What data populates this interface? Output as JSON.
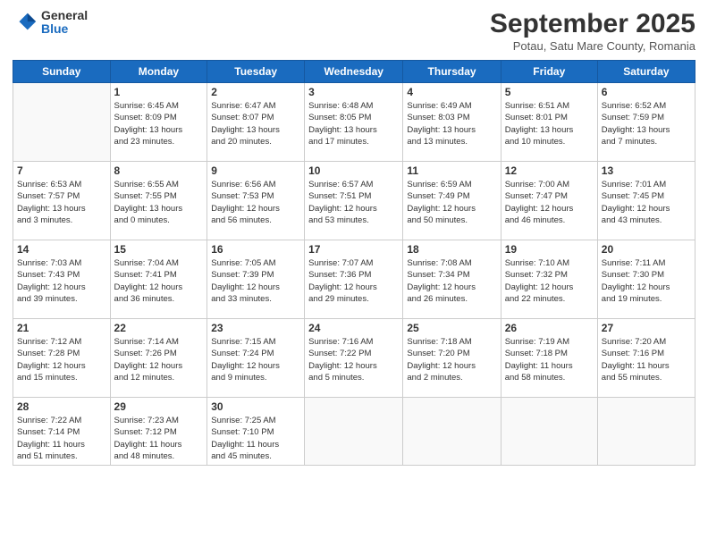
{
  "header": {
    "logo": {
      "general": "General",
      "blue": "Blue"
    },
    "title": "September 2025",
    "subtitle": "Potau, Satu Mare County, Romania"
  },
  "days_of_week": [
    "Sunday",
    "Monday",
    "Tuesday",
    "Wednesday",
    "Thursday",
    "Friday",
    "Saturday"
  ],
  "weeks": [
    [
      {
        "day": "",
        "info": ""
      },
      {
        "day": "1",
        "info": "Sunrise: 6:45 AM\nSunset: 8:09 PM\nDaylight: 13 hours\nand 23 minutes."
      },
      {
        "day": "2",
        "info": "Sunrise: 6:47 AM\nSunset: 8:07 PM\nDaylight: 13 hours\nand 20 minutes."
      },
      {
        "day": "3",
        "info": "Sunrise: 6:48 AM\nSunset: 8:05 PM\nDaylight: 13 hours\nand 17 minutes."
      },
      {
        "day": "4",
        "info": "Sunrise: 6:49 AM\nSunset: 8:03 PM\nDaylight: 13 hours\nand 13 minutes."
      },
      {
        "day": "5",
        "info": "Sunrise: 6:51 AM\nSunset: 8:01 PM\nDaylight: 13 hours\nand 10 minutes."
      },
      {
        "day": "6",
        "info": "Sunrise: 6:52 AM\nSunset: 7:59 PM\nDaylight: 13 hours\nand 7 minutes."
      }
    ],
    [
      {
        "day": "7",
        "info": "Sunrise: 6:53 AM\nSunset: 7:57 PM\nDaylight: 13 hours\nand 3 minutes."
      },
      {
        "day": "8",
        "info": "Sunrise: 6:55 AM\nSunset: 7:55 PM\nDaylight: 13 hours\nand 0 minutes."
      },
      {
        "day": "9",
        "info": "Sunrise: 6:56 AM\nSunset: 7:53 PM\nDaylight: 12 hours\nand 56 minutes."
      },
      {
        "day": "10",
        "info": "Sunrise: 6:57 AM\nSunset: 7:51 PM\nDaylight: 12 hours\nand 53 minutes."
      },
      {
        "day": "11",
        "info": "Sunrise: 6:59 AM\nSunset: 7:49 PM\nDaylight: 12 hours\nand 50 minutes."
      },
      {
        "day": "12",
        "info": "Sunrise: 7:00 AM\nSunset: 7:47 PM\nDaylight: 12 hours\nand 46 minutes."
      },
      {
        "day": "13",
        "info": "Sunrise: 7:01 AM\nSunset: 7:45 PM\nDaylight: 12 hours\nand 43 minutes."
      }
    ],
    [
      {
        "day": "14",
        "info": "Sunrise: 7:03 AM\nSunset: 7:43 PM\nDaylight: 12 hours\nand 39 minutes."
      },
      {
        "day": "15",
        "info": "Sunrise: 7:04 AM\nSunset: 7:41 PM\nDaylight: 12 hours\nand 36 minutes."
      },
      {
        "day": "16",
        "info": "Sunrise: 7:05 AM\nSunset: 7:39 PM\nDaylight: 12 hours\nand 33 minutes."
      },
      {
        "day": "17",
        "info": "Sunrise: 7:07 AM\nSunset: 7:36 PM\nDaylight: 12 hours\nand 29 minutes."
      },
      {
        "day": "18",
        "info": "Sunrise: 7:08 AM\nSunset: 7:34 PM\nDaylight: 12 hours\nand 26 minutes."
      },
      {
        "day": "19",
        "info": "Sunrise: 7:10 AM\nSunset: 7:32 PM\nDaylight: 12 hours\nand 22 minutes."
      },
      {
        "day": "20",
        "info": "Sunrise: 7:11 AM\nSunset: 7:30 PM\nDaylight: 12 hours\nand 19 minutes."
      }
    ],
    [
      {
        "day": "21",
        "info": "Sunrise: 7:12 AM\nSunset: 7:28 PM\nDaylight: 12 hours\nand 15 minutes."
      },
      {
        "day": "22",
        "info": "Sunrise: 7:14 AM\nSunset: 7:26 PM\nDaylight: 12 hours\nand 12 minutes."
      },
      {
        "day": "23",
        "info": "Sunrise: 7:15 AM\nSunset: 7:24 PM\nDaylight: 12 hours\nand 9 minutes."
      },
      {
        "day": "24",
        "info": "Sunrise: 7:16 AM\nSunset: 7:22 PM\nDaylight: 12 hours\nand 5 minutes."
      },
      {
        "day": "25",
        "info": "Sunrise: 7:18 AM\nSunset: 7:20 PM\nDaylight: 12 hours\nand 2 minutes."
      },
      {
        "day": "26",
        "info": "Sunrise: 7:19 AM\nSunset: 7:18 PM\nDaylight: 11 hours\nand 58 minutes."
      },
      {
        "day": "27",
        "info": "Sunrise: 7:20 AM\nSunset: 7:16 PM\nDaylight: 11 hours\nand 55 minutes."
      }
    ],
    [
      {
        "day": "28",
        "info": "Sunrise: 7:22 AM\nSunset: 7:14 PM\nDaylight: 11 hours\nand 51 minutes."
      },
      {
        "day": "29",
        "info": "Sunrise: 7:23 AM\nSunset: 7:12 PM\nDaylight: 11 hours\nand 48 minutes."
      },
      {
        "day": "30",
        "info": "Sunrise: 7:25 AM\nSunset: 7:10 PM\nDaylight: 11 hours\nand 45 minutes."
      },
      {
        "day": "",
        "info": ""
      },
      {
        "day": "",
        "info": ""
      },
      {
        "day": "",
        "info": ""
      },
      {
        "day": "",
        "info": ""
      }
    ]
  ]
}
